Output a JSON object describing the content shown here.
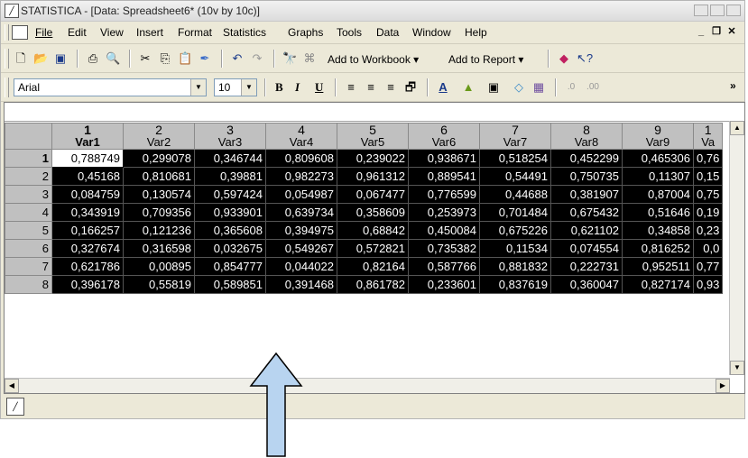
{
  "window": {
    "title": "STATISTICA - [Data: Spreadsheet6* (10v by 10c)]",
    "app_icon": "statistica-icon"
  },
  "menu": {
    "items": [
      "File",
      "Edit",
      "View",
      "Insert",
      "Format",
      "Statistics",
      "Graphs",
      "Tools",
      "Data",
      "Window",
      "Help"
    ],
    "mdi_buttons": [
      "_",
      "B",
      "✕"
    ]
  },
  "toolbar1": {
    "add_to_workbook": "Add to Workbook ▾",
    "add_to_report": "Add to Report ▾"
  },
  "toolbar2": {
    "font_name": "Arial",
    "font_size": "10",
    "bold": "B",
    "italic": "I",
    "underline": "U",
    "overflow": "»"
  },
  "sheet": {
    "columns": [
      {
        "num": "1",
        "name": "Var1"
      },
      {
        "num": "2",
        "name": "Var2"
      },
      {
        "num": "3",
        "name": "Var3"
      },
      {
        "num": "4",
        "name": "Var4"
      },
      {
        "num": "5",
        "name": "Var5"
      },
      {
        "num": "6",
        "name": "Var6"
      },
      {
        "num": "7",
        "name": "Var7"
      },
      {
        "num": "8",
        "name": "Var8"
      },
      {
        "num": "9",
        "name": "Var9"
      },
      {
        "num": "1",
        "name": "Va"
      }
    ],
    "rows": [
      {
        "label": "1",
        "cells": [
          "0,788749",
          "0,299078",
          "0,346744",
          "0,809608",
          "0,239022",
          "0,938671",
          "0,518254",
          "0,452299",
          "0,465306",
          "0,76"
        ]
      },
      {
        "label": "2",
        "cells": [
          "0,45168",
          "0,810681",
          "0,39881",
          "0,982273",
          "0,961312",
          "0,889541",
          "0,54491",
          "0,750735",
          "0,11307",
          "0,15"
        ]
      },
      {
        "label": "3",
        "cells": [
          "0,084759",
          "0,130574",
          "0,597424",
          "0,054987",
          "0,067477",
          "0,776599",
          "0,44688",
          "0,381907",
          "0,87004",
          "0,75"
        ]
      },
      {
        "label": "4",
        "cells": [
          "0,343919",
          "0,709356",
          "0,933901",
          "0,639734",
          "0,358609",
          "0,253973",
          "0,701484",
          "0,675432",
          "0,51646",
          "0,19"
        ]
      },
      {
        "label": "5",
        "cells": [
          "0,166257",
          "0,121236",
          "0,365608",
          "0,394975",
          "0,68842",
          "0,450084",
          "0,675226",
          "0,621102",
          "0,34858",
          "0,23"
        ]
      },
      {
        "label": "6",
        "cells": [
          "0,327674",
          "0,316598",
          "0,032675",
          "0,549267",
          "0,572821",
          "0,735382",
          "0,11534",
          "0,074554",
          "0,816252",
          "0,0"
        ]
      },
      {
        "label": "7",
        "cells": [
          "0,621786",
          "0,00895",
          "0,854777",
          "0,044022",
          "0,82164",
          "0,587766",
          "0,881832",
          "0,222731",
          "0,952511",
          "0,77"
        ]
      },
      {
        "label": "8",
        "cells": [
          "0,396178",
          "0,55819",
          "0,589851",
          "0,391468",
          "0,861782",
          "0,233601",
          "0,837619",
          "0,360047",
          "0,827174",
          "0,93"
        ]
      }
    ]
  },
  "annotation": {
    "arrow_color": "#b8d4f0",
    "arrow_stroke": "#000000"
  }
}
